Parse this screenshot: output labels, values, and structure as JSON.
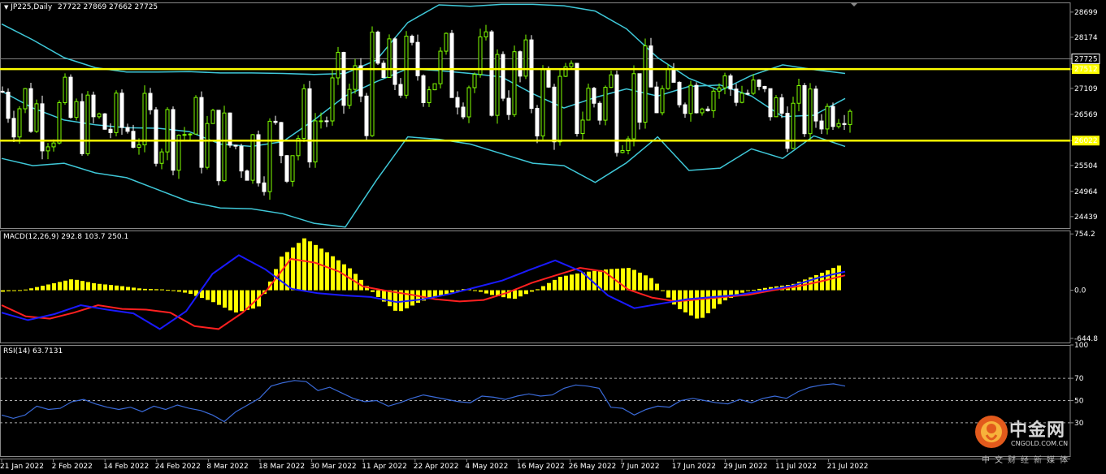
{
  "header": {
    "symbol": "JP225,Daily",
    "ohlc": "27722 27869 27662 27725"
  },
  "macd_header": "MACD(12,26,9) 292.8 103.7 250.1",
  "rsi_header": "RSI(14) 63.7131",
  "watermark": {
    "cn": "中金网",
    "en": "CNGOLD.COM.CN",
    "sub": "中文财经新媒体"
  },
  "chart_data": [
    {
      "type": "candlestick",
      "title": "JP225,Daily",
      "ylim": [
        24200,
        28900
      ],
      "yticks": [
        28699,
        28174,
        27725,
        27512,
        27109,
        26569,
        26022,
        25504,
        24964,
        24439
      ],
      "price_labels": {
        "current": "27725",
        "upper_line": "27512",
        "lower_line": "26022"
      },
      "horizontal_lines": [
        27512,
        26022
      ],
      "line_colors": {
        "levels": "#ffff00",
        "bollinger": "#3fc8d8",
        "bull": "#7fff00",
        "bear": "#ffffff",
        "current": "#808080"
      },
      "x_labels": [
        "21 Jan 2022",
        "2 Feb 2022",
        "14 Feb 2022",
        "24 Feb 2022",
        "8 Mar 2022",
        "18 Mar 2022",
        "30 Mar 2022",
        "11 Apr 2022",
        "22 Apr 2022",
        "4 May 2022",
        "16 May 2022",
        "26 May 2022",
        "7 Jun 2022",
        "17 Jun 2022",
        "29 Jun 2022",
        "11 Jul 2022",
        "21 Jul 2022"
      ],
      "bb_upper": [
        28450,
        28120,
        27750,
        27540,
        27450,
        27450,
        27460,
        27430,
        27430,
        27420,
        27400,
        27420,
        27700,
        28480,
        28850,
        28820,
        28860,
        28860,
        28830,
        28720,
        28350,
        27750,
        27320,
        27060,
        27380,
        27600,
        27500,
        27420
      ],
      "bb_mid": [
        27050,
        26700,
        26450,
        26350,
        26290,
        26280,
        26210,
        25950,
        25900,
        26000,
        26450,
        26950,
        27250,
        27520,
        27480,
        27420,
        27350,
        27000,
        26700,
        26920,
        27100,
        26950,
        27150,
        27180,
        26950,
        26520,
        26550,
        26900
      ],
      "bb_lower": [
        25650,
        25500,
        25550,
        25350,
        25250,
        25000,
        24750,
        24620,
        24600,
        24500,
        24300,
        24220,
        25200,
        26100,
        26050,
        25950,
        25750,
        25550,
        25500,
        25150,
        25560,
        26100,
        25400,
        25450,
        25850,
        25650,
        26120,
        25900
      ]
    },
    {
      "type": "bar+line",
      "title": "MACD(12,26,9) 292.8 103.7 250.1",
      "ylim": [
        -700,
        800
      ],
      "yticks": [
        754.2,
        0.0,
        -644.8
      ],
      "series": [
        {
          "name": "MACD",
          "values": [
            -20,
            10,
            80,
            150,
            90,
            60,
            20,
            10,
            -40,
            -150,
            -300,
            -230,
            450,
            700,
            500,
            280,
            -50,
            -300,
            -150,
            -60,
            30,
            -60,
            -120,
            10,
            180,
            240,
            280,
            300,
            150,
            -230,
            -400,
            -150,
            -10,
            40,
            80,
            200,
            330
          ]
        },
        {
          "name": "Signal",
          "values": [
            -200,
            -350,
            -380,
            -300,
            -200,
            -250,
            -260,
            -300,
            -480,
            -520,
            -300,
            0,
            420,
            370,
            250,
            50,
            -10,
            -60,
            -120,
            -150,
            -130,
            -30,
            100,
            200,
            300,
            250,
            10,
            -100,
            -150,
            -120,
            -90,
            -60,
            0,
            50,
            120,
            200
          ]
        },
        {
          "name": "Main",
          "values": [
            -300,
            -400,
            -320,
            -200,
            -260,
            -310,
            -520,
            -280,
            220,
            470,
            280,
            20,
            -40,
            -70,
            -90,
            -160,
            -120,
            -50,
            40,
            130,
            270,
            400,
            250,
            -70,
            -240,
            -180,
            -120,
            -90,
            -60,
            0,
            60,
            170,
            250
          ]
        }
      ],
      "colors": {
        "histogram": "#ffff00",
        "signal": "#ff2020",
        "main": "#1a1aff"
      }
    },
    {
      "type": "line",
      "title": "RSI(14) 63.7131",
      "ylim": [
        0,
        100
      ],
      "yticks": [
        100,
        70,
        50,
        30
      ],
      "levels": [
        70,
        50,
        30
      ],
      "color": "#3a6ad8",
      "values": [
        37,
        34,
        37,
        45,
        42,
        43,
        49,
        51,
        47,
        44,
        42,
        44,
        40,
        45,
        42,
        46,
        43,
        41,
        37,
        31,
        40,
        46,
        52,
        63,
        66,
        68,
        67,
        59,
        62,
        57,
        52,
        49,
        50,
        45,
        48,
        52,
        55,
        53,
        51,
        49,
        48,
        54,
        53,
        51,
        54,
        56,
        54,
        55,
        61,
        64,
        63,
        61,
        44,
        43,
        37,
        42,
        45,
        44,
        50,
        52,
        50,
        48,
        47,
        51,
        48,
        52,
        54,
        52,
        58,
        62,
        64,
        65,
        63
      ]
    }
  ]
}
